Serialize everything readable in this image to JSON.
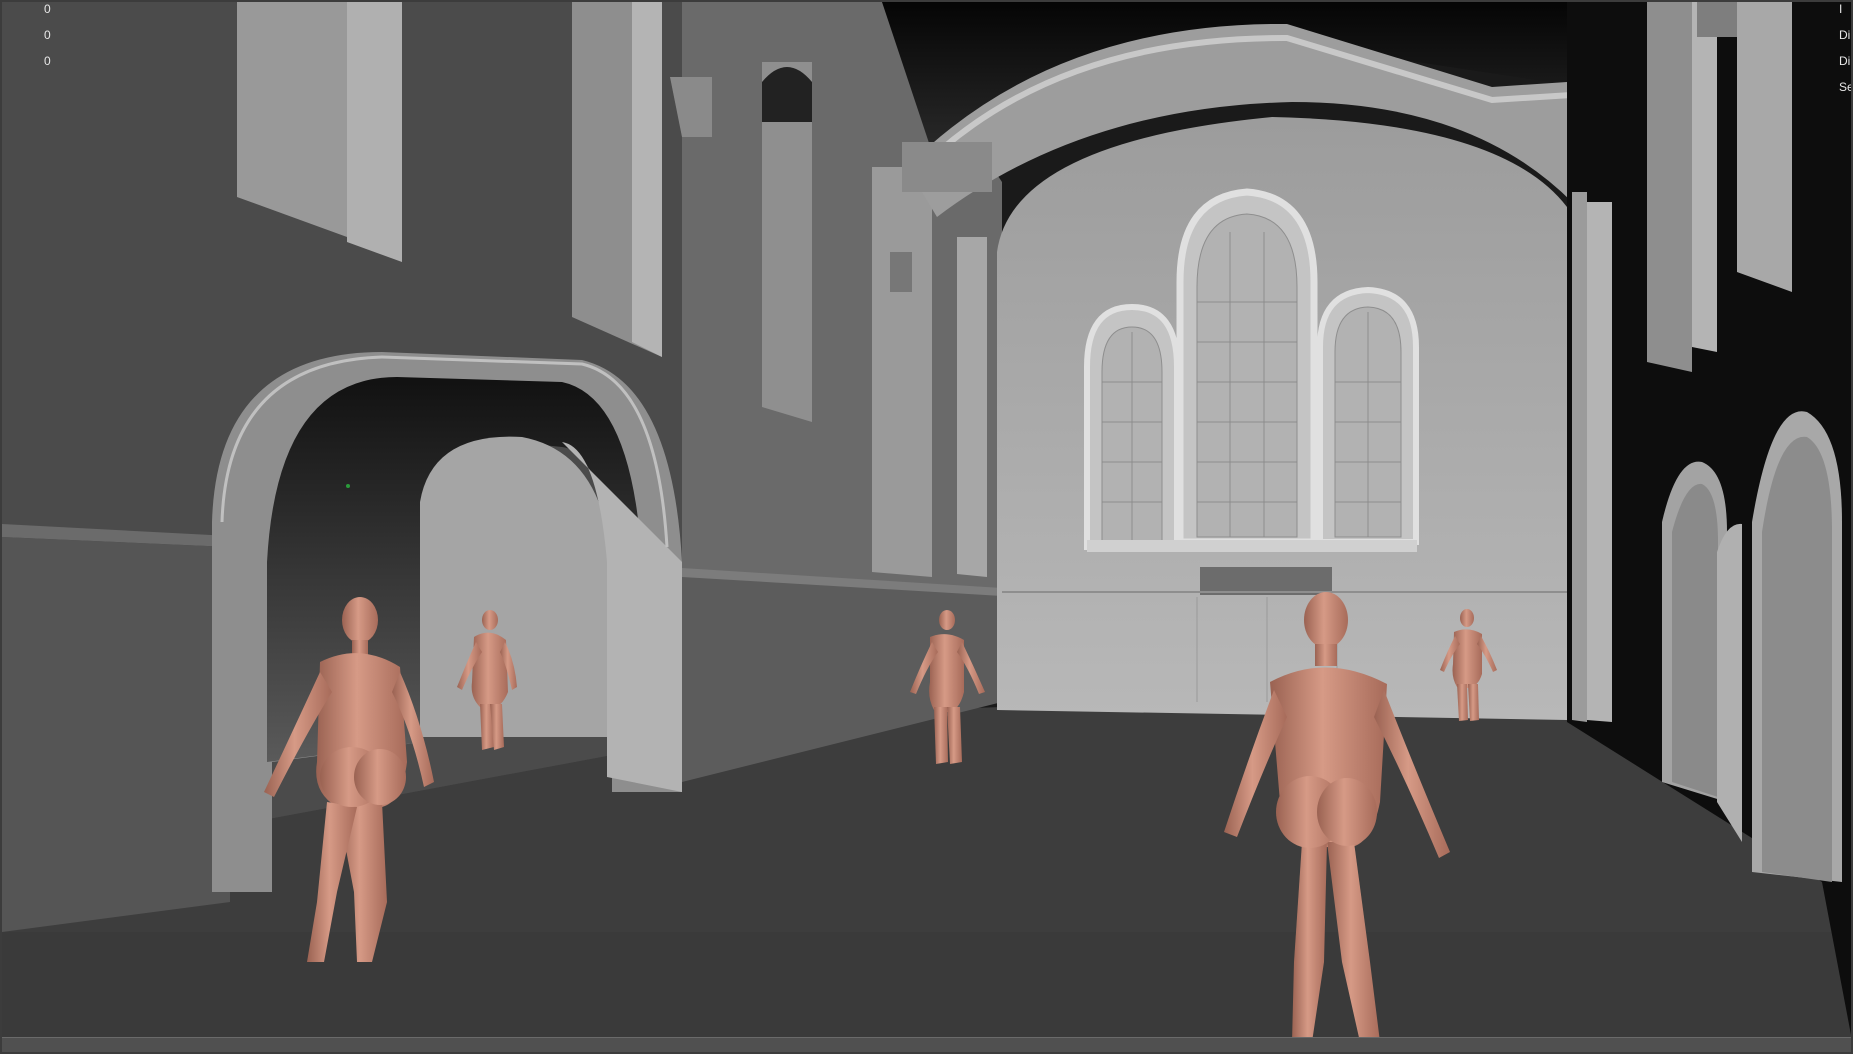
{
  "viewport": {
    "hud_left_values": [
      "0",
      "0",
      "0"
    ],
    "hud_right_labels": [
      "I",
      "Di",
      "Di",
      "Se"
    ]
  },
  "scene": {
    "figures": [
      {
        "name": "mannequin-left-foreground"
      },
      {
        "name": "mannequin-under-arch"
      },
      {
        "name": "mannequin-center"
      },
      {
        "name": "mannequin-right-foreground"
      },
      {
        "name": "mannequin-far-right"
      }
    ],
    "colors": {
      "skin": "#c58a78",
      "floor": "#3d3d3d",
      "wall_dark": "#4e4e4e",
      "wall_light": "#a9a9a9",
      "background": "#1a1a1a"
    }
  }
}
